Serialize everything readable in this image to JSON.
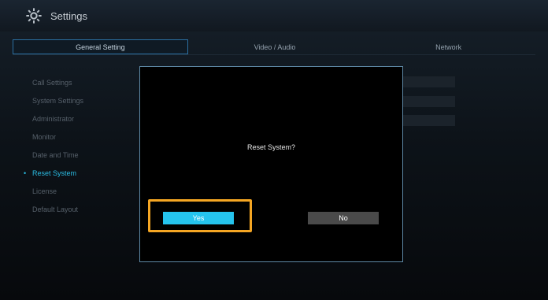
{
  "window": {
    "title": "Settings",
    "icon": "gear-icon"
  },
  "tabs": [
    {
      "label": "General Setting",
      "active": true
    },
    {
      "label": "Video / Audio",
      "active": false
    },
    {
      "label": "Network",
      "active": false
    }
  ],
  "sidebar": {
    "items": [
      {
        "label": "Call Settings"
      },
      {
        "label": "System Settings"
      },
      {
        "label": "Administrator"
      },
      {
        "label": "Monitor"
      },
      {
        "label": "Date and Time"
      },
      {
        "label": "Reset System",
        "selected": true
      },
      {
        "label": "License"
      },
      {
        "label": "Default Layout"
      }
    ],
    "selection_marker": "•"
  },
  "dialog": {
    "message": "Reset System?",
    "yes_label": "Yes",
    "no_label": "No"
  },
  "colors": {
    "accent": "#25c4ee",
    "highlight": "#f5a623",
    "dialog_border": "#5e89a6",
    "no_button": "#4a4a4a"
  }
}
